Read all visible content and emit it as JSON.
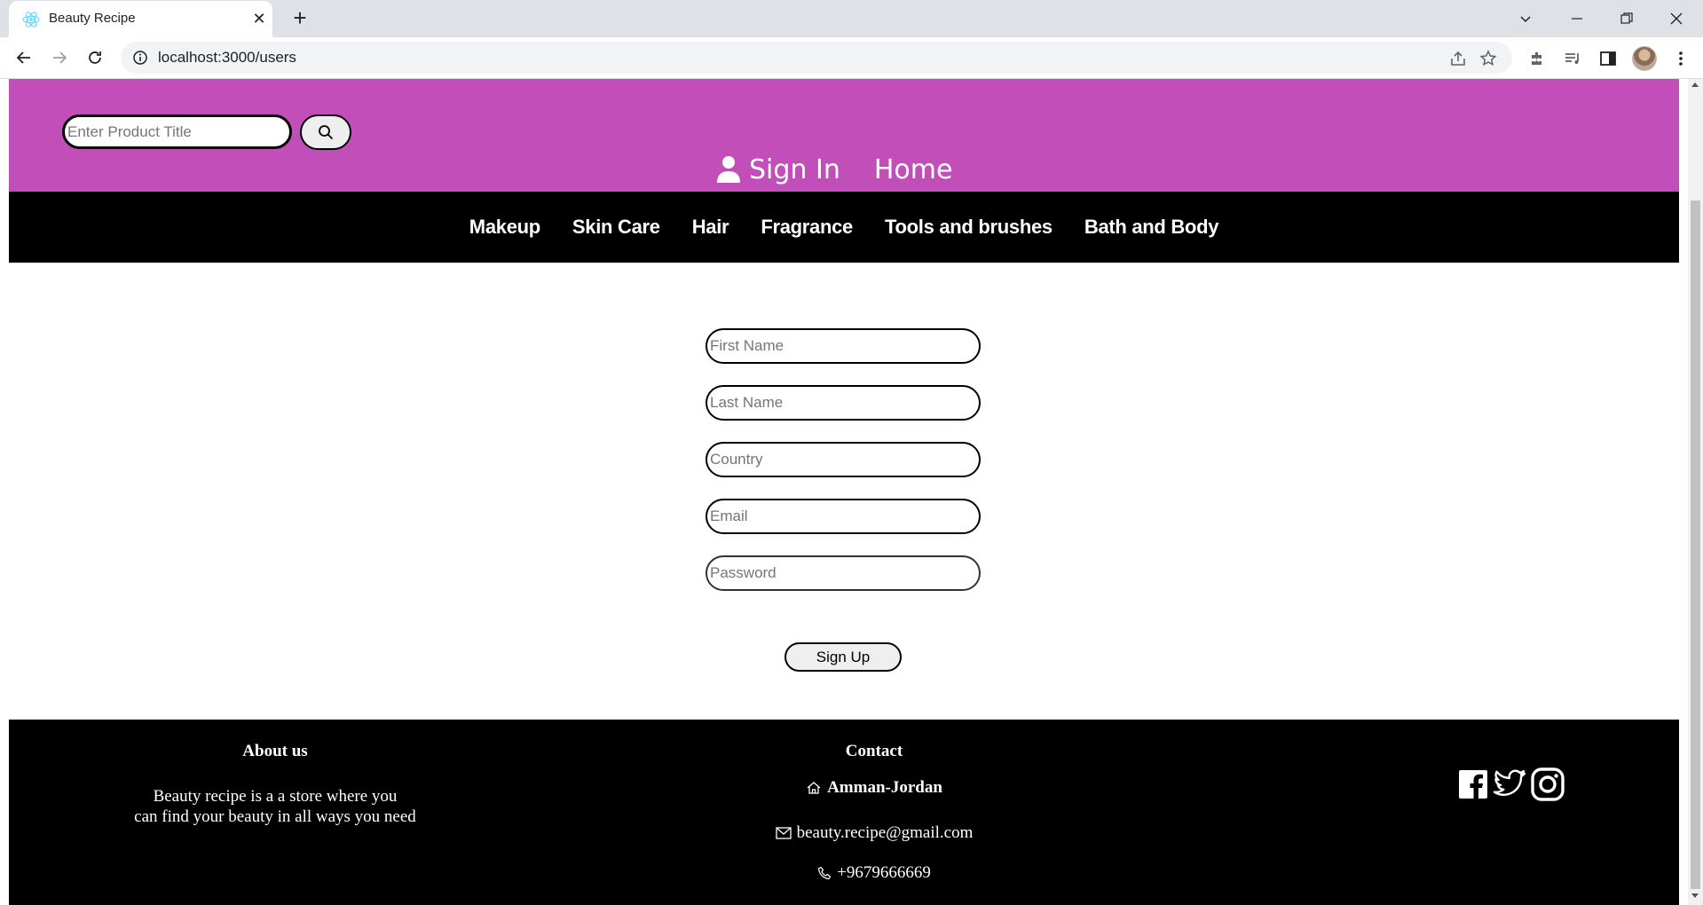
{
  "browser": {
    "tab_title": "Beauty Recipe",
    "url": "localhost:3000/users"
  },
  "header": {
    "search_placeholder": "Enter Product Title",
    "sign_in": "Sign In",
    "home": "Home"
  },
  "categories": [
    "Makeup",
    "Skin Care",
    "Hair",
    "Fragrance",
    "Tools and brushes",
    "Bath and Body"
  ],
  "form": {
    "first_name_placeholder": "First Name",
    "last_name_placeholder": "Last Name",
    "country_placeholder": "Country",
    "email_placeholder": "Email",
    "password_placeholder": "Password",
    "submit_label": "Sign Up"
  },
  "footer": {
    "about_heading": "About us",
    "about_line1": "Beauty recipe is a a store where you",
    "about_line2": "can find your beauty in all ways you need",
    "contact_heading": "Contact",
    "address": "Amman-Jordan",
    "email": "beauty.recipe@gmail.com",
    "phone": "+9679666669"
  },
  "colors": {
    "header_bg": "#c24fb9",
    "nav_bg": "#000000",
    "footer_bg": "#000000"
  },
  "icons": [
    "react-icon",
    "search-icon",
    "user-icon",
    "home-icon",
    "mail-icon",
    "phone-icon",
    "facebook-icon",
    "twitter-icon",
    "instagram-icon"
  ]
}
